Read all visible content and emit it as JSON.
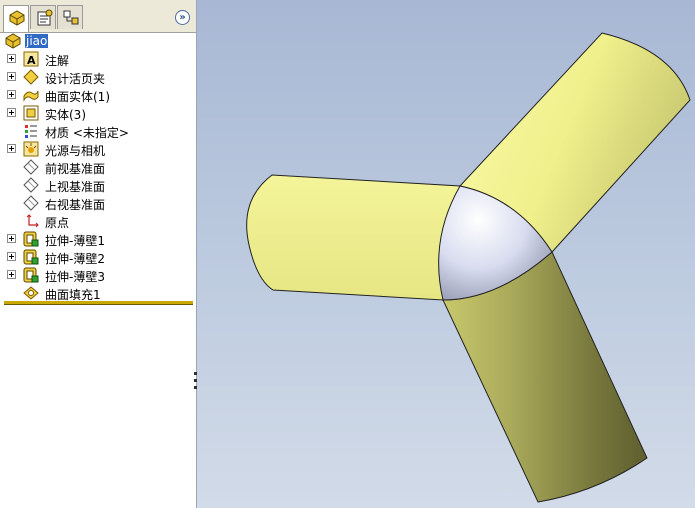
{
  "feature_tree": {
    "root": {
      "label": "jiao",
      "icon": "part-icon"
    },
    "items": [
      {
        "label": "注解",
        "icon": "annotation-icon",
        "expandable": true
      },
      {
        "label": "设计活页夹",
        "icon": "design-binder-icon",
        "expandable": true
      },
      {
        "label": "曲面实体(1)",
        "icon": "surface-bodies-icon",
        "expandable": true
      },
      {
        "label": "实体(3)",
        "icon": "solid-bodies-icon",
        "expandable": true
      },
      {
        "label": "材质 <未指定>",
        "icon": "material-icon",
        "expandable": false
      },
      {
        "label": "光源与相机",
        "icon": "lights-cameras-icon",
        "expandable": true
      },
      {
        "label": "前视基准面",
        "icon": "plane-icon",
        "expandable": false
      },
      {
        "label": "上视基准面",
        "icon": "plane-icon",
        "expandable": false
      },
      {
        "label": "右视基准面",
        "icon": "plane-icon",
        "expandable": false
      },
      {
        "label": "原点",
        "icon": "origin-icon",
        "expandable": false
      },
      {
        "label": "拉伸-薄壁1",
        "icon": "extrude-thin-icon",
        "expandable": true
      },
      {
        "label": "拉伸-薄壁2",
        "icon": "extrude-thin-icon",
        "expandable": true
      },
      {
        "label": "拉伸-薄壁3",
        "icon": "extrude-thin-icon",
        "expandable": true
      },
      {
        "label": "曲面填充1",
        "icon": "fill-surface-icon",
        "expandable": false
      }
    ]
  },
  "tabs": [
    {
      "icon": "feature-manager-icon",
      "active": true
    },
    {
      "icon": "property-manager-icon",
      "active": false
    },
    {
      "icon": "configuration-manager-icon",
      "active": false
    }
  ],
  "colors": {
    "tube_yellow": "#f0f08c",
    "fill_surface": "#d8dcef",
    "viewport_top": "#a8b8d4",
    "viewport_bottom": "#d2dbe8",
    "selection": "#316ac5",
    "rollback_bar": "#c9a800"
  }
}
